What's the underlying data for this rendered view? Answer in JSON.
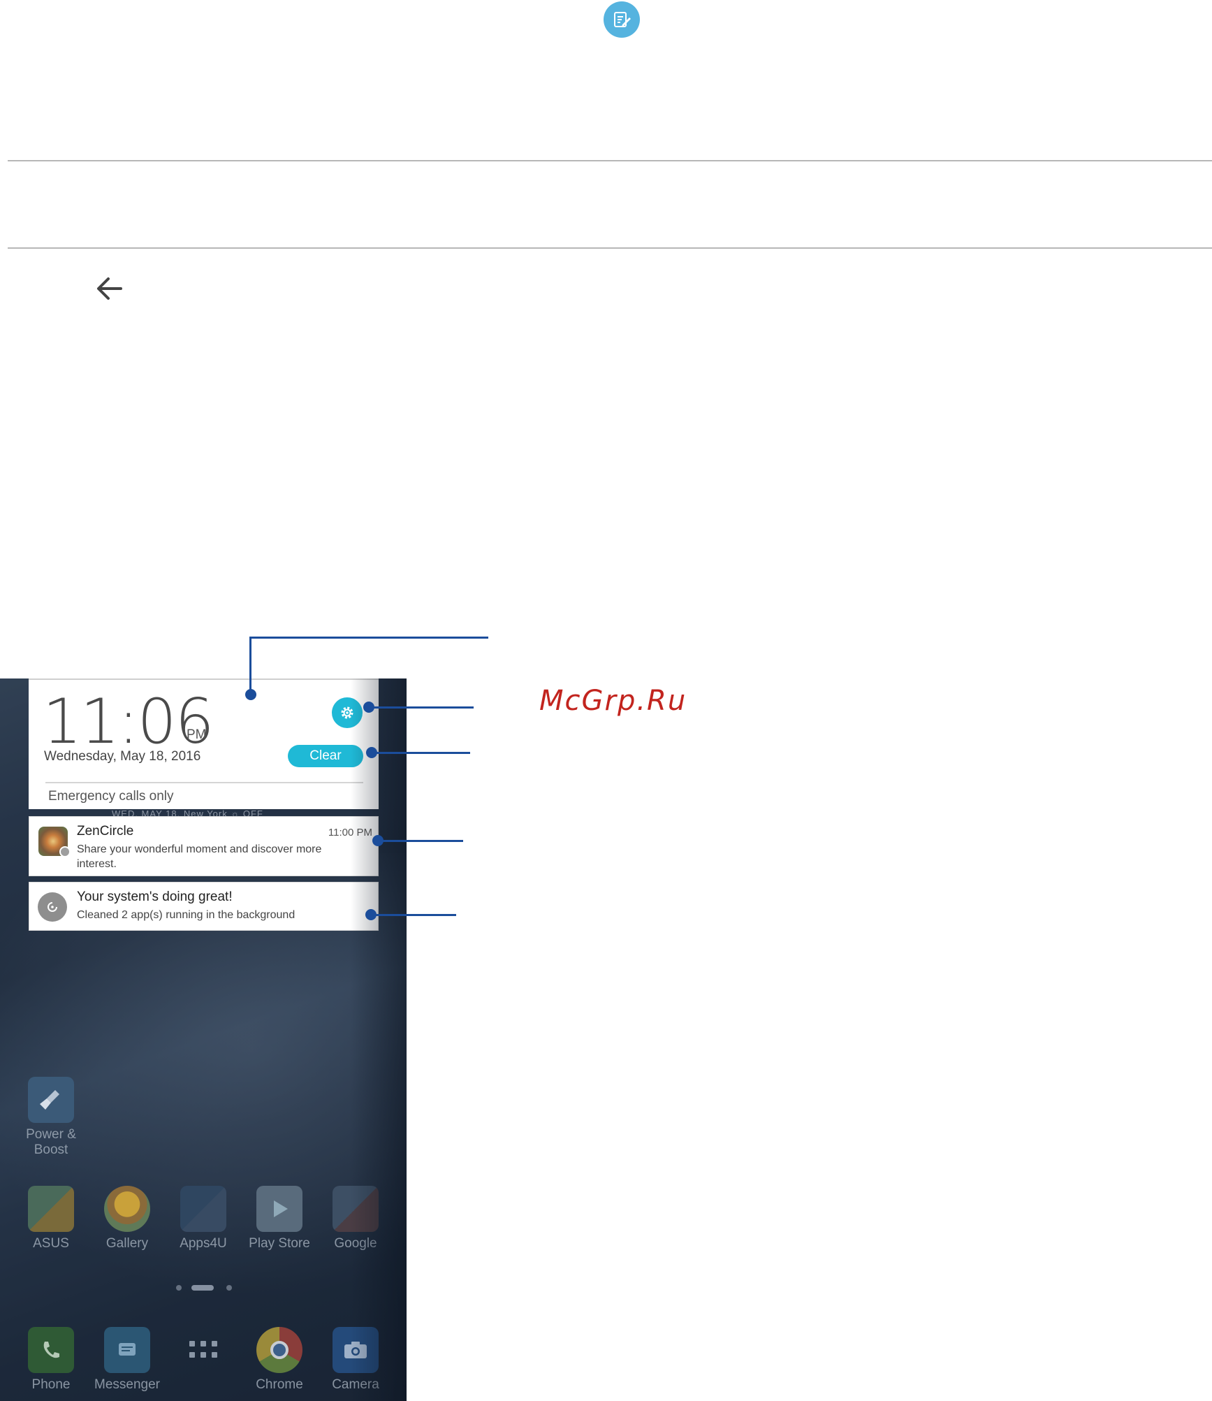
{
  "header": {
    "note_icon": "note-edit-icon"
  },
  "nav": {
    "back_icon": "back-arrow-icon"
  },
  "watermark": {
    "text": "McGrp.Ru"
  },
  "phone": {
    "shade": {
      "clock_time": "11:06",
      "clock_ampm": "PM",
      "date": "Wednesday, May 18, 2016",
      "clear_label": "Clear",
      "status": "Emergency calls only",
      "peek_text": "WED, MAY 18, New York  ☼ OFF"
    },
    "notifications": [
      {
        "title": "ZenCircle",
        "time": "11:00 PM",
        "body": "Share your wonderful moment and discover more interest."
      },
      {
        "title": "Your system's doing great!",
        "body": "Cleaned 2 app(s) running in the background"
      }
    ],
    "apps_row1": [
      {
        "label": "Power &\nBoost",
        "label_l1": "Power &",
        "label_l2": "Boost"
      }
    ],
    "apps_row2": [
      {
        "label": "ASUS"
      },
      {
        "label": "Gallery"
      },
      {
        "label": "Apps4U"
      },
      {
        "label": "Play Store"
      },
      {
        "label": "Google"
      }
    ],
    "dock": [
      {
        "label": "Phone"
      },
      {
        "label": "Messenger"
      },
      {
        "label": ""
      },
      {
        "label": "Chrome"
      },
      {
        "label": "Camera"
      }
    ]
  },
  "colors": {
    "accent": "#1fb9d6",
    "callout": "#1b4d9b",
    "watermark": "#c2241e"
  }
}
